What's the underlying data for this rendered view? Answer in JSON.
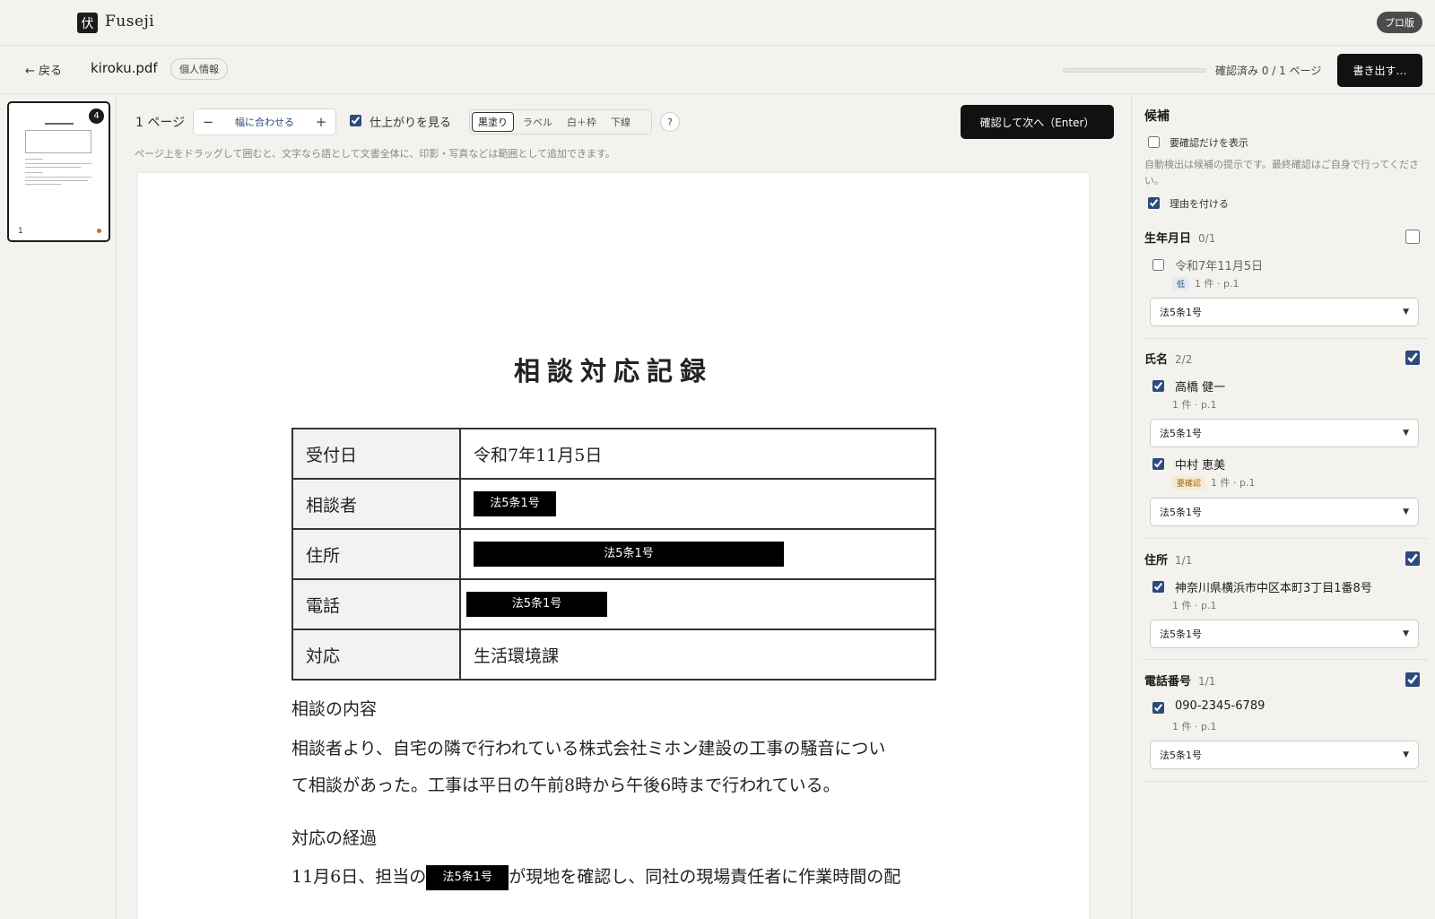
{
  "app": {
    "logo_glyph": "伏",
    "name": "Fuseji",
    "plan_badge": "プロ版"
  },
  "filebar": {
    "back": "← 戻る",
    "file_name": "kiroku.pdf",
    "file_tag": "個人情報",
    "progress_fraction": 0,
    "progress_text": "確認済み 0 / 1 ページ",
    "export": "書き出す…"
  },
  "thumbs": [
    {
      "page": "1",
      "badge": "4"
    }
  ],
  "toolbar": {
    "page_count": "1 ページ",
    "zoom_minus": "−",
    "zoom_fit": "幅に合わせる",
    "zoom_plus": "+",
    "finish_label": "仕上がりを見る",
    "modes": [
      "黒塗り",
      "ラベル",
      "白＋枠",
      "下線"
    ],
    "active_mode": "黒塗り",
    "help": "?",
    "confirm": "確認して次へ（Enter）",
    "hint": "ページ上をドラッグして囲むと、文字なら語として文書全体に、印影・写真などは範囲として追加できます。"
  },
  "document": {
    "title": "相談対応記録",
    "rows": [
      {
        "label": "受付日",
        "value": "令和7年11月5日"
      },
      {
        "label": "相談者",
        "redaction": "法5条1号"
      },
      {
        "label": "住所",
        "redaction": "法5条1号"
      },
      {
        "label": "電話",
        "redaction": "法5条1号"
      },
      {
        "label": "対応",
        "value": "生活環境課"
      }
    ],
    "heading1": "相談の内容",
    "para1_line1": "相談者より、自宅の隣で行われている株式会社ミホン建設の工事の騒音につい",
    "para1_line2": "て相談があった。工事は平日の午前8時から午後6時まで行われている。",
    "heading2": "対応の経過",
    "para2_before": "11月6日、担当の",
    "para2_redaction": "法5条1号",
    "para2_after": "が現地を確認し、同社の現場責任者に作業時間の配"
  },
  "panel": {
    "title": "候補",
    "only_check_label": "要確認だけを表示",
    "note": "自動検出は候補の提示です。最終確認はご自身で行ってください。",
    "reason_label": "理由を付ける",
    "groups": [
      {
        "label": "生年月日",
        "count": "0/1",
        "items": [
          {
            "text": "令和7年11月5日",
            "tag": "低",
            "meta": "1 件 · p.1",
            "reason": "法5条1号",
            "checked": false
          }
        ]
      },
      {
        "label": "氏名",
        "count": "2/2",
        "items": [
          {
            "text": "高橋 健一",
            "meta": "1 件 · p.1",
            "reason": "法5条1号",
            "checked": true
          },
          {
            "text": "中村 恵美",
            "tag": "要確認",
            "meta": "1 件 · p.1",
            "reason": "法5条1号",
            "checked": true
          }
        ]
      },
      {
        "label": "住所",
        "count": "1/1",
        "items": [
          {
            "text": "神奈川県横浜市中区本町3丁目1番8号",
            "meta": "1 件 · p.1",
            "reason": "法5条1号",
            "checked": true
          }
        ]
      },
      {
        "label": "電話番号",
        "count": "1/1",
        "items": [
          {
            "text": "090-2345-6789",
            "meta": "1 件 · p.1",
            "reason": "法5条1号",
            "checked": true
          }
        ]
      }
    ]
  },
  "colors": {
    "accent": "#2c4a7a",
    "dark": "#111111",
    "background": "#f3f2ee",
    "warning_tag": "#a06a10"
  }
}
